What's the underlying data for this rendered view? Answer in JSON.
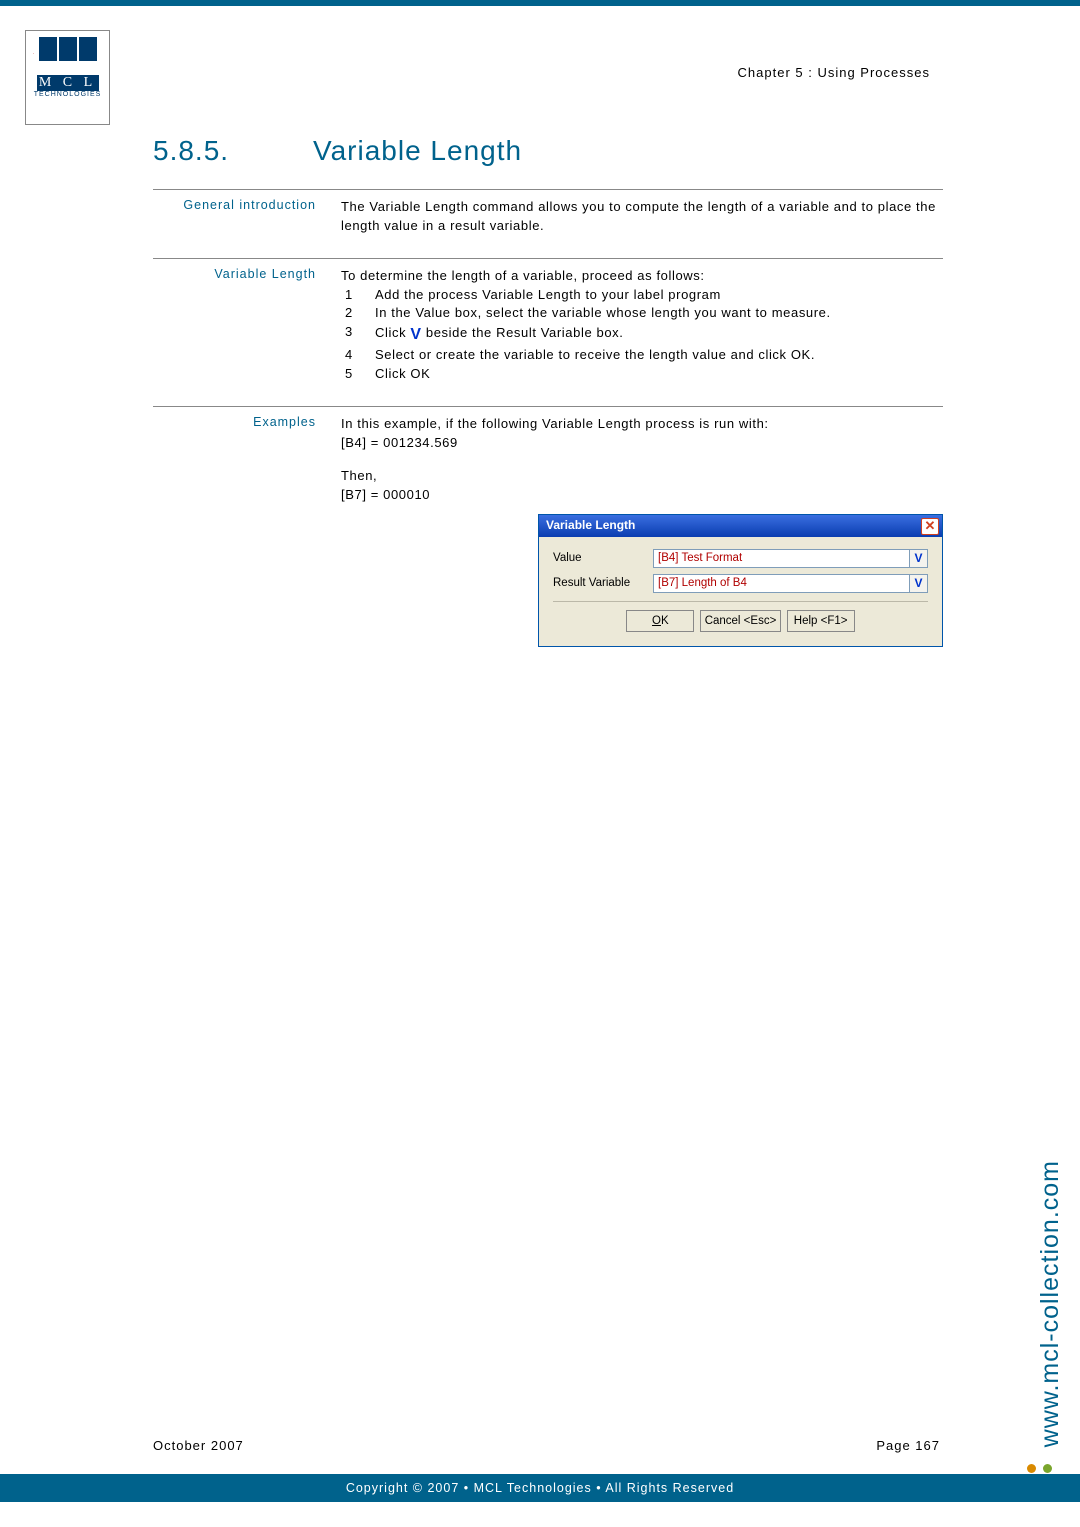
{
  "chapter": "Chapter 5 : Using Processes",
  "title_num": "5.8.5.",
  "title_text": "Variable Length",
  "sections": {
    "intro": {
      "label": "General introduction",
      "text": "The Variable Length command allows you to compute the length of a variable and to place the length value in a result variable."
    },
    "steps": {
      "label": "Variable Length",
      "lead": "To determine the length of a variable, proceed as follows:",
      "items": [
        "Add the process Variable Length to your label program",
        "In the Value box, select the variable whose length you want to measure.",
        "Click  beside the Result Variable box.",
        "Select or create the variable to receive the length value and click OK.",
        "Click OK"
      ]
    },
    "examples": {
      "label": "Examples",
      "p1": "In this example, if the following Variable Length process is run with:",
      "p2": "[B4] = 001234.569",
      "p3": "Then,",
      "p4": "[B7] = 000010"
    }
  },
  "dialog": {
    "title": "Variable Length",
    "value_label": "Value",
    "value_input": "[B4] Test Format",
    "result_label": "Result Variable",
    "result_input": "[B7] Length of B4",
    "ok": "OK",
    "cancel": "Cancel <Esc>",
    "help": "Help <F1>"
  },
  "footer": {
    "date": "October 2007",
    "page": "Page 167",
    "copyright": "Copyright © 2007 • MCL Technologies • All Rights Reserved"
  },
  "side_url": "www.mcl-collection.com",
  "logo": {
    "txt": "M C L",
    "sub": "TECHNOLOGIES"
  }
}
